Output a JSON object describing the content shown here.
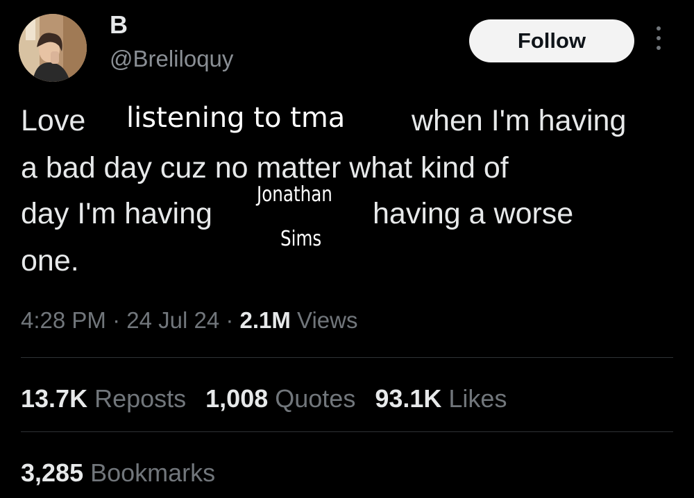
{
  "author": {
    "display_name": "B",
    "handle": "@Breliloquy"
  },
  "follow_label": "Follow",
  "tweet": {
    "line1_a": "Love",
    "line1_redacted": "listening to tma",
    "line1_b": "when I'm having",
    "line2": "a bad day cuz no matter what kind of",
    "line3_a": "day I'm having",
    "line3_b": "having a worse",
    "line4": "one.",
    "overlay_name_1": "Jonathan",
    "overlay_name_2": "Sims"
  },
  "meta": {
    "time": "4:28 PM",
    "sep1": " · ",
    "date": "24 Jul 24",
    "sep2": " · ",
    "views_count": "2.1M",
    "views_label": " Views"
  },
  "stats": {
    "reposts_count": "13.7K",
    "reposts_label": " Reposts",
    "quotes_count": "1,008",
    "quotes_label": " Quotes",
    "likes_count": "93.1K",
    "likes_label": " Likes",
    "bookmarks_count": "3,285",
    "bookmarks_label": " Bookmarks"
  },
  "icons": {
    "avatar": "avatar-photo",
    "more": "more-options-icon"
  },
  "colors": {
    "background": "#000000",
    "text": "#e7e9ea",
    "secondary": "#71767b",
    "follow_bg": "#f3f3f3"
  }
}
